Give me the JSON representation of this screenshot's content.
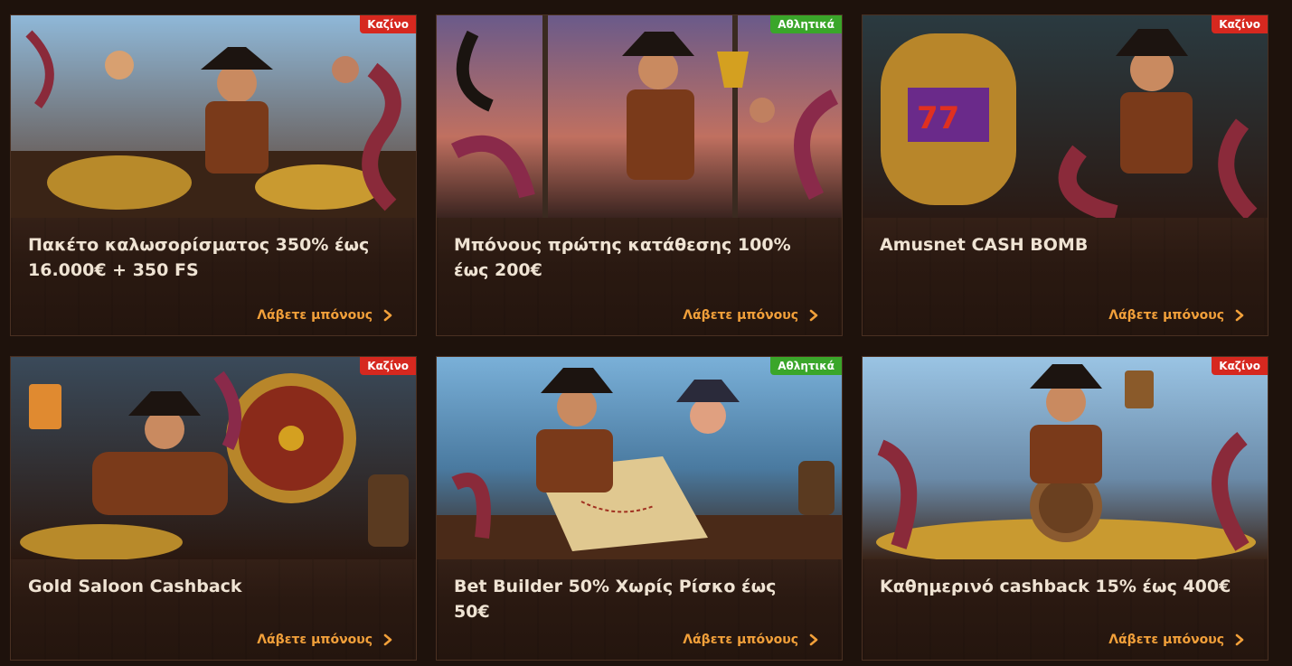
{
  "cards": [
    {
      "badge": "Καζίνο",
      "badge_type": "casino",
      "title": "Πακέτο καλωσορίσματος 350% έως 16.000€ + 350 FS",
      "cta": "Λάβετε μπόνους",
      "image_icon": "pirate-captain-treasure-image"
    },
    {
      "badge": "Αθλητικά",
      "badge_type": "sports",
      "title": "Μπόνους πρώτης κατάθεσης 100% έως 200€",
      "cta": "Λάβετε μπόνους",
      "image_icon": "pirate-trophy-image"
    },
    {
      "badge": "Καζίνο",
      "badge_type": "casino",
      "title": "Amusnet CASH BOMB",
      "cta": "Λάβετε μπόνους",
      "image_icon": "pirate-slot-machine-image"
    },
    {
      "badge": "Καζίνο",
      "badge_type": "casino",
      "title": "Gold Saloon Cashback",
      "cta": "Λάβετε μπόνους",
      "image_icon": "pirate-wheel-image"
    },
    {
      "badge": "Αθλητικά",
      "badge_type": "sports",
      "title": "Bet Builder 50% Χωρίς Ρίσκο έως 50€",
      "cta": "Λάβετε μπόνους",
      "image_icon": "pirate-treasure-map-image"
    },
    {
      "badge": "Καζίνο",
      "badge_type": "casino",
      "title": "Καθημερινό cashback 15% έως 400€",
      "cta": "Λάβετε μπόνους",
      "image_icon": "pirate-barrel-coins-image"
    }
  ],
  "colors": {
    "page_bg": "#1e120c",
    "casino_badge": "#d6281f",
    "sports_badge": "#3aa62a",
    "cta_text": "#f2a03a",
    "title_text": "#efe3d3"
  }
}
